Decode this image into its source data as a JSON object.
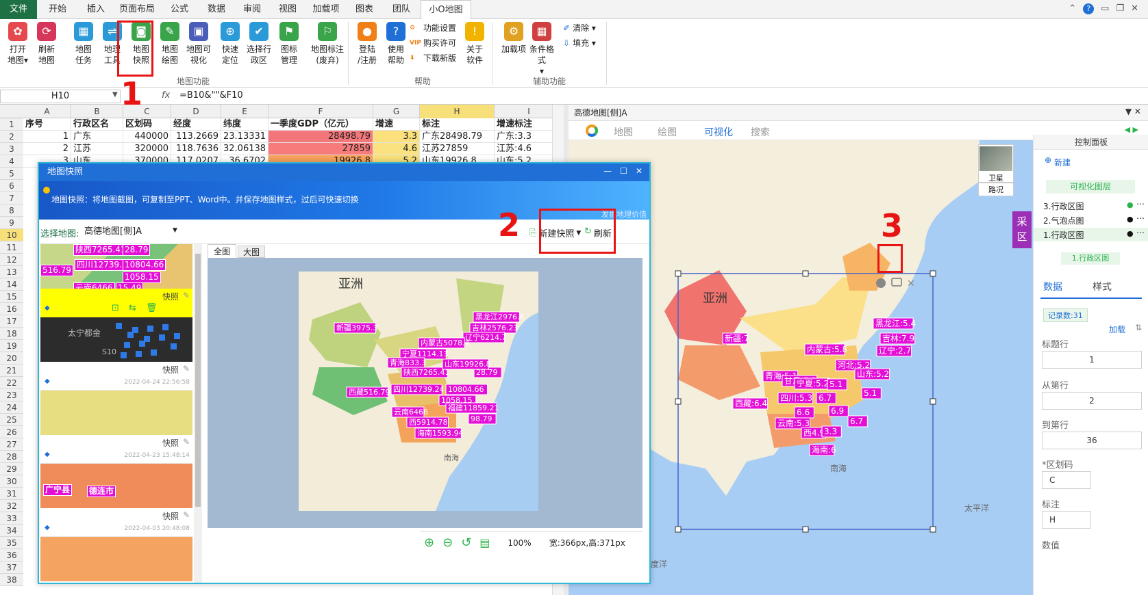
{
  "tabs": [
    "文件",
    "开始",
    "插入",
    "页面布局",
    "公式",
    "数据",
    "审阅",
    "视图",
    "加载项",
    "图表",
    "团队",
    "小O地图"
  ],
  "ribbon": {
    "buttons": [
      {
        "label1": "打开",
        "label2": "地图▾",
        "color": "#e5484d"
      },
      {
        "label1": "刷新",
        "label2": "地图",
        "color": "#d6365a"
      },
      {
        "label1": "地图",
        "label2": "任务",
        "color": "#2b9ad8"
      },
      {
        "label1": "地理",
        "label2": "工具",
        "color": "#2b9ad8"
      },
      {
        "label1": "地图",
        "label2": "快照",
        "color": "#3aa44b"
      },
      {
        "label1": "地图",
        "label2": "绘图",
        "color": "#3aa44b"
      },
      {
        "label1": "地图可",
        "label2": "视化",
        "color": "#4a5db8"
      },
      {
        "label1": "快速",
        "label2": "定位",
        "color": "#2b9ad8"
      },
      {
        "label1": "选择行",
        "label2": "政区",
        "color": "#2b9ad8"
      },
      {
        "label1": "图标",
        "label2": "管理",
        "color": "#3aa44b"
      },
      {
        "label1": "地图标注",
        "label2": "(废弃)",
        "color": "#3aa44b"
      },
      {
        "label1": "登陆",
        "label2": "/注册",
        "color": "#f07f16"
      },
      {
        "label1": "使用",
        "label2": "帮助",
        "color": "#1f6fd6"
      },
      {
        "label1": "关于",
        "label2": "软件",
        "color": "#f0b400"
      },
      {
        "label1": "加载项",
        "label2": "",
        "color": "#e0a020"
      },
      {
        "label1": "条件格式",
        "label2": "▾",
        "color": "#d04040"
      }
    ],
    "help_small": [
      "功能设置",
      "购买许可",
      "下载新版"
    ],
    "assist_small": [
      "清除 ▾",
      "填充 ▾"
    ],
    "groups": [
      "地图功能",
      "帮助",
      "辅助功能"
    ]
  },
  "formula": {
    "namebox": "H10",
    "fx": "fx",
    "formula": "=B10&\"\"&F10"
  },
  "grid": {
    "columns": [
      "A",
      "B",
      "C",
      "D",
      "E",
      "F",
      "G",
      "H",
      "I"
    ],
    "header": [
      "序号",
      "行政区名",
      "区划码",
      "经度",
      "纬度",
      "一季度GDP（亿元）",
      "增速",
      "标注",
      "增速标注"
    ],
    "rows": [
      [
        "1",
        "广东",
        "440000",
        "113.2669",
        "23.13331",
        "28498.79",
        "3.3",
        "广东28498.79",
        "广东:3.3"
      ],
      [
        "2",
        "江苏",
        "320000",
        "118.7636",
        "32.06138",
        "27859",
        "4.6",
        "江苏27859",
        "江苏:4.6"
      ],
      [
        "3",
        "山东",
        "370000",
        "117.0207",
        "36.6702",
        "19926.8",
        "5.2",
        "山东19926.8",
        "山东:5.2"
      ]
    ],
    "row_numbers": [
      "1",
      "2",
      "3",
      "4",
      "5",
      "6",
      "7",
      "8",
      "9",
      "10",
      "11",
      "12",
      "13",
      "14",
      "15",
      "16",
      "17",
      "18",
      "19",
      "20",
      "21",
      "22",
      "23",
      "24",
      "25",
      "26",
      "27",
      "28",
      "29",
      "30",
      "31",
      "32",
      "33",
      "34",
      "35",
      "36",
      "37",
      "38"
    ]
  },
  "dialog": {
    "title": "地图快照",
    "banner": "地图快照：将地图截图，可复制至PPT、Word中。并保存地图样式，过后可快速切换",
    "banner_tag": "发掘地理价值",
    "select_label": "选择地图:",
    "select_value": "高德地图[侧]A",
    "new_snapshot": "新建快照",
    "refresh": "刷新",
    "tabs": [
      "全图",
      "大图"
    ],
    "thumb_label": "快照",
    "dates": [
      "2022-04-24 22:56:58",
      "2022-04-23 15:48:14",
      "2022-04-03 20:48:08"
    ],
    "zoom": "100%",
    "size": "宽:366px,高:371px",
    "preview_title": "亚洲",
    "preview_sea": "南海",
    "preview_labels": [
      "新疆3975.3",
      "黑龙江2976.6",
      "吉林2576.23",
      "辽宁6214.7",
      "内蒙古5078.4",
      "宁夏1114.13",
      "青海833.3",
      "陕西7265.41",
      "西藏516.79",
      "四川12739.24",
      "10804.66",
      "1058.15",
      "云南6466",
      "福建11859.21",
      "西5914.78",
      "98.79",
      "海南1593.94",
      "28.79",
      "山东19926.8"
    ]
  },
  "thumb_labels": [
    "陕西7265.41",
    "28.79",
    "四川12739.24",
    "10804.66",
    "1058.15",
    "云南6466",
    "516.79",
    "15.49",
    "太宁都金",
    "S10",
    "广宁县",
    "德连市"
  ],
  "map": {
    "pane_title": "高德地图[侧]A",
    "tabs": [
      "地图",
      "绘图",
      "可视化",
      "搜索"
    ],
    "satellite": "卫星",
    "traffic": "路况",
    "collect": "采区",
    "asia": "亚洲",
    "sea": "南海",
    "pacific": "太平洋",
    "baidu": "度洋",
    "labels": [
      "黑龙江:5.4",
      "吉林:7.9",
      "新疆:7",
      "内蒙古:5.8",
      "辽宁:2.7",
      "河北:5.2",
      "山东:5.2",
      "青海:5.1",
      "甘肃:5.3",
      "宁夏:5.2",
      "5.1",
      "西藏:6.4",
      "四川:5.3",
      "6.7",
      "5.1",
      "6.6",
      "6.9",
      "6.7",
      "云南:5.3",
      "西4.9",
      "3.3",
      "海南:6"
    ]
  },
  "control": {
    "title": "控制面板",
    "new": "新建",
    "layer_group": "可视化图层",
    "layers": [
      "3.行政区图",
      "2.气泡点图",
      "1.行政区图"
    ],
    "current_layer": "1.行政区图",
    "tabs": [
      "数据",
      "样式"
    ],
    "records": "记录数:31",
    "load": "加载",
    "title_row": "标题行",
    "title_row_val": "1",
    "from_row": "从第行",
    "from_row_val": "2",
    "to_row": "到第行",
    "to_row_val": "36",
    "code_label": "*区划码",
    "code_val": "C",
    "note_label": "标注",
    "note_val": "H",
    "value_label": "数值"
  },
  "steps": [
    "1",
    "2",
    "3"
  ]
}
